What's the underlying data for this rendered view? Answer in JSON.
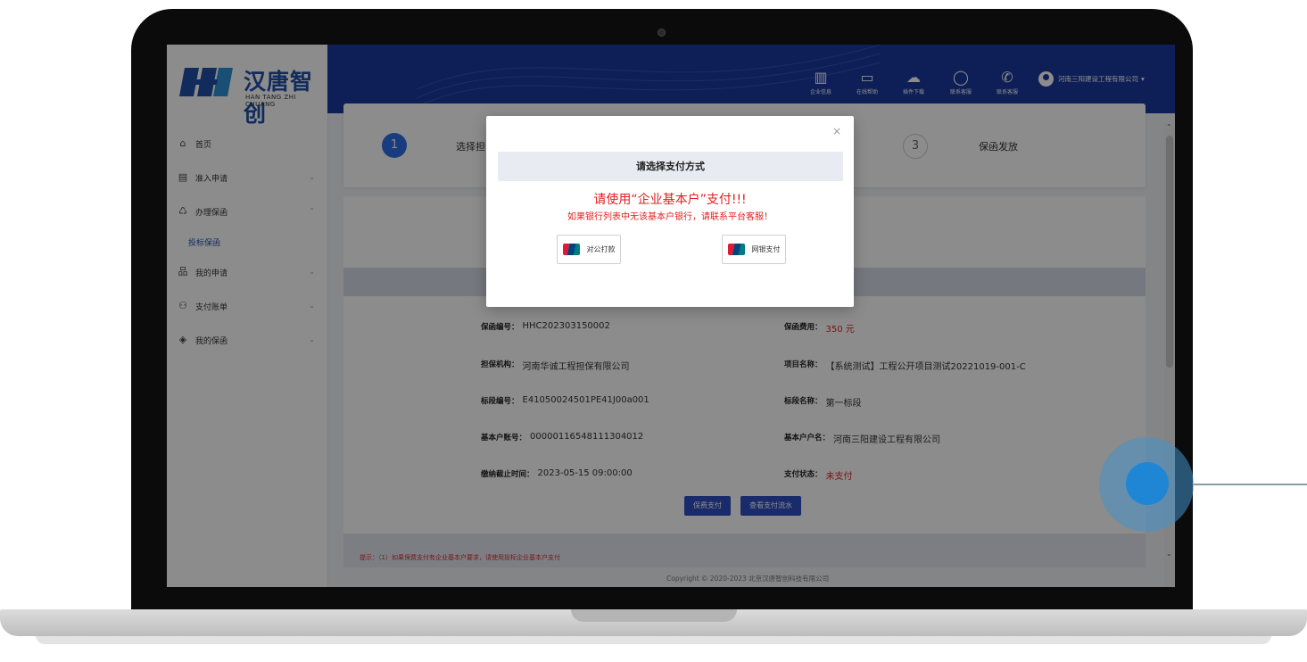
{
  "brand": {
    "name_cn": "汉唐智创",
    "name_en": "HAN TANG ZHI CHUANG"
  },
  "sidebar": {
    "items": [
      {
        "label": "首页",
        "icon": "home-icon"
      },
      {
        "label": "准入申请",
        "icon": "document-icon"
      },
      {
        "label": "办理保函",
        "icon": "recycle-icon"
      },
      {
        "label": "投标保函",
        "icon": ""
      },
      {
        "label": "我的申请",
        "icon": "org-chart-icon"
      },
      {
        "label": "支付账单",
        "icon": "users-icon"
      },
      {
        "label": "我的保函",
        "icon": "layers-icon"
      }
    ]
  },
  "topbar": {
    "items": [
      {
        "label": "企业信息",
        "icon": "building-icon"
      },
      {
        "label": "在线帮助",
        "icon": "help-doc-icon"
      },
      {
        "label": "插件下载",
        "icon": "cloud-download-icon"
      },
      {
        "label": "联系客服",
        "icon": "bell-icon"
      },
      {
        "label": "联系客服",
        "icon": "phone-icon"
      }
    ],
    "user": "河南三阳建设工程有限公司"
  },
  "steps": [
    {
      "num": "1",
      "label": "选择担"
    },
    {
      "num": "3",
      "label": "保函发放"
    }
  ],
  "details": {
    "rows": [
      {
        "k1": "保函编号：",
        "v1": "HHC202303150002",
        "k2": "保函费用：",
        "v2": "350 元"
      },
      {
        "k1": "担保机构：",
        "v1": "河南华诚工程担保有限公司",
        "k2": "项目名称：",
        "v2": "【系统测试】工程公开项目测试20221019-001-C"
      },
      {
        "k1": "标段编号：",
        "v1": "E41050024501PE41J00a001",
        "k2": "标段名称：",
        "v2": "第一标段"
      },
      {
        "k1": "基本户账号：",
        "v1": "00000116548111304012",
        "k2": "基本户户名：",
        "v2": "河南三阳建设工程有限公司"
      },
      {
        "k1": "缴纳截止时间：",
        "v1": "2023-05-15 09:00:00",
        "k2": "支付状态：",
        "v2": "未支付"
      }
    ],
    "pay_button": "保费支付",
    "flow_button": "查看支付流水"
  },
  "tip": "提示：（1）如果保费支付有企业基本户要求，请使用投标企业基本户支付",
  "copyright": "Copyright © 2020-2023 北京汉唐智创科技有限公司",
  "modal": {
    "close": "×",
    "header": "请选择支付方式",
    "title": "请使用“企业基本户”支付!!!",
    "subtitle": "如果银行列表中无该基本户银行，请联系平台客服！",
    "option1": "对公打款",
    "option2": "网银支付"
  },
  "colors": {
    "primary": "#1a3a9f",
    "accent": "#2e6ee6",
    "alert": "#e02020"
  }
}
